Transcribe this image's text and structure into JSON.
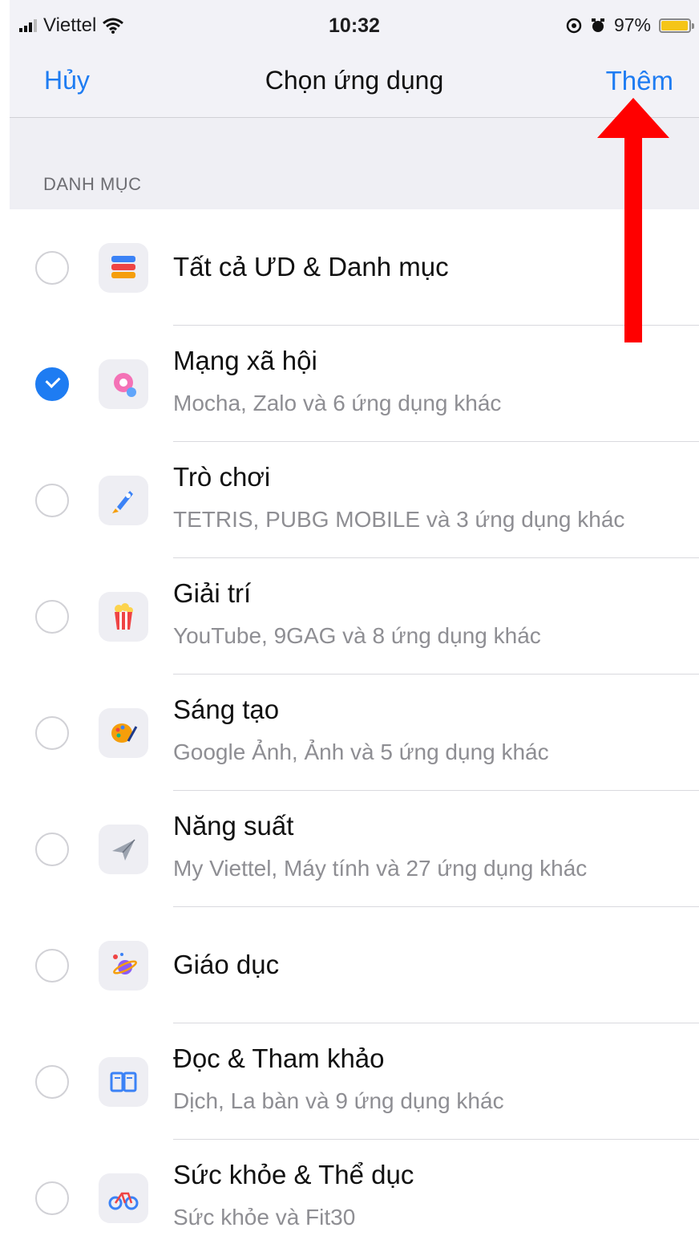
{
  "status_bar": {
    "carrier": "Viettel",
    "time": "10:32",
    "battery": "97%",
    "battery_level": 0.97
  },
  "nav": {
    "cancel": "Hủy",
    "title": "Chọn ứng dụng",
    "add": "Thêm"
  },
  "section_header": "DANH MỤC",
  "categories": [
    {
      "title": "Tất cả ƯD & Danh mục",
      "subtitle": "",
      "checked": false,
      "icon": "stack-layers-icon"
    },
    {
      "title": "Mạng xã hội",
      "subtitle": "Mocha, Zalo và 6 ứng dụng khác",
      "checked": true,
      "icon": "social-chat-icon"
    },
    {
      "title": "Trò chơi",
      "subtitle": "TETRIS, PUBG MOBILE và 3 ứng dụng khác",
      "checked": false,
      "icon": "rocket-icon"
    },
    {
      "title": "Giải trí",
      "subtitle": "YouTube, 9GAG và 8 ứng dụng khác",
      "checked": false,
      "icon": "popcorn-icon"
    },
    {
      "title": "Sáng tạo",
      "subtitle": "Google Ảnh, Ảnh và 5 ứng dụng khác",
      "checked": false,
      "icon": "palette-icon"
    },
    {
      "title": "Năng suất",
      "subtitle": "My Viettel, Máy tính và 27 ứng dụng khác",
      "checked": false,
      "icon": "paper-plane-icon"
    },
    {
      "title": "Giáo dục",
      "subtitle": "",
      "checked": false,
      "icon": "planet-icon"
    },
    {
      "title": "Đọc & Tham khảo",
      "subtitle": "Dịch, La bàn và 9 ứng dụng khác",
      "checked": false,
      "icon": "book-icon"
    },
    {
      "title": "Sức khỏe & Thể dục",
      "subtitle": "Sức khỏe và Fit30",
      "checked": false,
      "icon": "bicycle-icon"
    }
  ],
  "colors": {
    "accent": "#1e7cf2",
    "annotation_arrow": "#ff0000"
  }
}
